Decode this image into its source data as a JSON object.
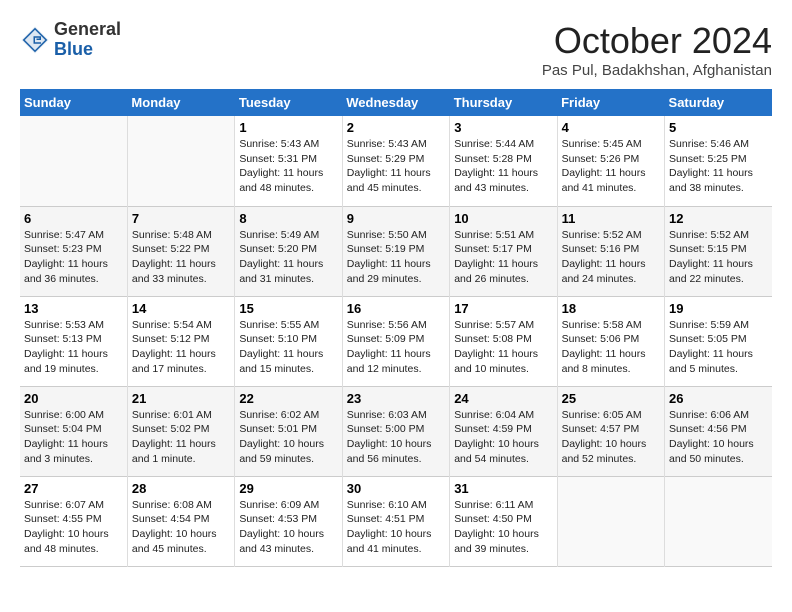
{
  "header": {
    "logo_general": "General",
    "logo_blue": "Blue",
    "month": "October 2024",
    "location": "Pas Pul, Badakhshan, Afghanistan"
  },
  "weekdays": [
    "Sunday",
    "Monday",
    "Tuesday",
    "Wednesday",
    "Thursday",
    "Friday",
    "Saturday"
  ],
  "weeks": [
    [
      {
        "day": "",
        "sunrise": "",
        "sunset": "",
        "daylight": ""
      },
      {
        "day": "",
        "sunrise": "",
        "sunset": "",
        "daylight": ""
      },
      {
        "day": "1",
        "sunrise": "Sunrise: 5:43 AM",
        "sunset": "Sunset: 5:31 PM",
        "daylight": "Daylight: 11 hours and 48 minutes."
      },
      {
        "day": "2",
        "sunrise": "Sunrise: 5:43 AM",
        "sunset": "Sunset: 5:29 PM",
        "daylight": "Daylight: 11 hours and 45 minutes."
      },
      {
        "day": "3",
        "sunrise": "Sunrise: 5:44 AM",
        "sunset": "Sunset: 5:28 PM",
        "daylight": "Daylight: 11 hours and 43 minutes."
      },
      {
        "day": "4",
        "sunrise": "Sunrise: 5:45 AM",
        "sunset": "Sunset: 5:26 PM",
        "daylight": "Daylight: 11 hours and 41 minutes."
      },
      {
        "day": "5",
        "sunrise": "Sunrise: 5:46 AM",
        "sunset": "Sunset: 5:25 PM",
        "daylight": "Daylight: 11 hours and 38 minutes."
      }
    ],
    [
      {
        "day": "6",
        "sunrise": "Sunrise: 5:47 AM",
        "sunset": "Sunset: 5:23 PM",
        "daylight": "Daylight: 11 hours and 36 minutes."
      },
      {
        "day": "7",
        "sunrise": "Sunrise: 5:48 AM",
        "sunset": "Sunset: 5:22 PM",
        "daylight": "Daylight: 11 hours and 33 minutes."
      },
      {
        "day": "8",
        "sunrise": "Sunrise: 5:49 AM",
        "sunset": "Sunset: 5:20 PM",
        "daylight": "Daylight: 11 hours and 31 minutes."
      },
      {
        "day": "9",
        "sunrise": "Sunrise: 5:50 AM",
        "sunset": "Sunset: 5:19 PM",
        "daylight": "Daylight: 11 hours and 29 minutes."
      },
      {
        "day": "10",
        "sunrise": "Sunrise: 5:51 AM",
        "sunset": "Sunset: 5:17 PM",
        "daylight": "Daylight: 11 hours and 26 minutes."
      },
      {
        "day": "11",
        "sunrise": "Sunrise: 5:52 AM",
        "sunset": "Sunset: 5:16 PM",
        "daylight": "Daylight: 11 hours and 24 minutes."
      },
      {
        "day": "12",
        "sunrise": "Sunrise: 5:52 AM",
        "sunset": "Sunset: 5:15 PM",
        "daylight": "Daylight: 11 hours and 22 minutes."
      }
    ],
    [
      {
        "day": "13",
        "sunrise": "Sunrise: 5:53 AM",
        "sunset": "Sunset: 5:13 PM",
        "daylight": "Daylight: 11 hours and 19 minutes."
      },
      {
        "day": "14",
        "sunrise": "Sunrise: 5:54 AM",
        "sunset": "Sunset: 5:12 PM",
        "daylight": "Daylight: 11 hours and 17 minutes."
      },
      {
        "day": "15",
        "sunrise": "Sunrise: 5:55 AM",
        "sunset": "Sunset: 5:10 PM",
        "daylight": "Daylight: 11 hours and 15 minutes."
      },
      {
        "day": "16",
        "sunrise": "Sunrise: 5:56 AM",
        "sunset": "Sunset: 5:09 PM",
        "daylight": "Daylight: 11 hours and 12 minutes."
      },
      {
        "day": "17",
        "sunrise": "Sunrise: 5:57 AM",
        "sunset": "Sunset: 5:08 PM",
        "daylight": "Daylight: 11 hours and 10 minutes."
      },
      {
        "day": "18",
        "sunrise": "Sunrise: 5:58 AM",
        "sunset": "Sunset: 5:06 PM",
        "daylight": "Daylight: 11 hours and 8 minutes."
      },
      {
        "day": "19",
        "sunrise": "Sunrise: 5:59 AM",
        "sunset": "Sunset: 5:05 PM",
        "daylight": "Daylight: 11 hours and 5 minutes."
      }
    ],
    [
      {
        "day": "20",
        "sunrise": "Sunrise: 6:00 AM",
        "sunset": "Sunset: 5:04 PM",
        "daylight": "Daylight: 11 hours and 3 minutes."
      },
      {
        "day": "21",
        "sunrise": "Sunrise: 6:01 AM",
        "sunset": "Sunset: 5:02 PM",
        "daylight": "Daylight: 11 hours and 1 minute."
      },
      {
        "day": "22",
        "sunrise": "Sunrise: 6:02 AM",
        "sunset": "Sunset: 5:01 PM",
        "daylight": "Daylight: 10 hours and 59 minutes."
      },
      {
        "day": "23",
        "sunrise": "Sunrise: 6:03 AM",
        "sunset": "Sunset: 5:00 PM",
        "daylight": "Daylight: 10 hours and 56 minutes."
      },
      {
        "day": "24",
        "sunrise": "Sunrise: 6:04 AM",
        "sunset": "Sunset: 4:59 PM",
        "daylight": "Daylight: 10 hours and 54 minutes."
      },
      {
        "day": "25",
        "sunrise": "Sunrise: 6:05 AM",
        "sunset": "Sunset: 4:57 PM",
        "daylight": "Daylight: 10 hours and 52 minutes."
      },
      {
        "day": "26",
        "sunrise": "Sunrise: 6:06 AM",
        "sunset": "Sunset: 4:56 PM",
        "daylight": "Daylight: 10 hours and 50 minutes."
      }
    ],
    [
      {
        "day": "27",
        "sunrise": "Sunrise: 6:07 AM",
        "sunset": "Sunset: 4:55 PM",
        "daylight": "Daylight: 10 hours and 48 minutes."
      },
      {
        "day": "28",
        "sunrise": "Sunrise: 6:08 AM",
        "sunset": "Sunset: 4:54 PM",
        "daylight": "Daylight: 10 hours and 45 minutes."
      },
      {
        "day": "29",
        "sunrise": "Sunrise: 6:09 AM",
        "sunset": "Sunset: 4:53 PM",
        "daylight": "Daylight: 10 hours and 43 minutes."
      },
      {
        "day": "30",
        "sunrise": "Sunrise: 6:10 AM",
        "sunset": "Sunset: 4:51 PM",
        "daylight": "Daylight: 10 hours and 41 minutes."
      },
      {
        "day": "31",
        "sunrise": "Sunrise: 6:11 AM",
        "sunset": "Sunset: 4:50 PM",
        "daylight": "Daylight: 10 hours and 39 minutes."
      },
      {
        "day": "",
        "sunrise": "",
        "sunset": "",
        "daylight": ""
      },
      {
        "day": "",
        "sunrise": "",
        "sunset": "",
        "daylight": ""
      }
    ]
  ]
}
